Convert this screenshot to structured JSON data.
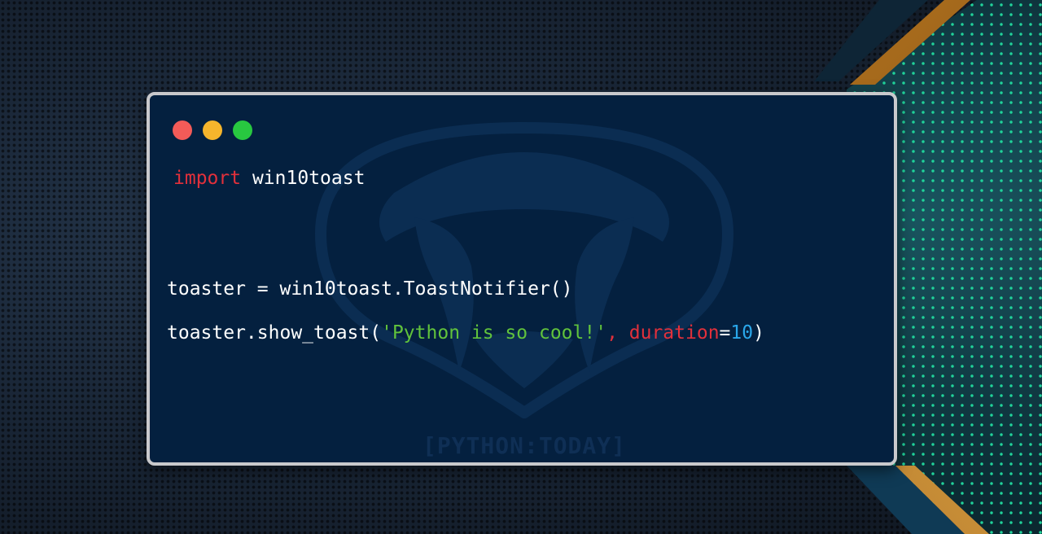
{
  "window": {
    "controls": [
      "close",
      "minimize",
      "maximize"
    ]
  },
  "code": {
    "line1": {
      "keyword": "import",
      "module": "win10toast"
    },
    "line2": {
      "text": "toaster = win10toast.ToastNotifier()"
    },
    "line3": {
      "call": "toaster.show_toast(",
      "string": "'Python is so cool!'",
      "comma": ", ",
      "param": "duration",
      "equals": "=",
      "number": "10",
      "close": ")"
    }
  },
  "watermark": {
    "text": "[PYTHON:TODAY]"
  },
  "colors": {
    "keyword": "#e2303b",
    "string": "#61c33c",
    "number": "#2aa7ea",
    "window_bg": "#04203f",
    "close_dot": "#f35b58",
    "minimize_dot": "#f6b52c",
    "maximize_dot": "#28c840"
  },
  "icons": {
    "watermark_logo": "snake-fangs-logo"
  }
}
